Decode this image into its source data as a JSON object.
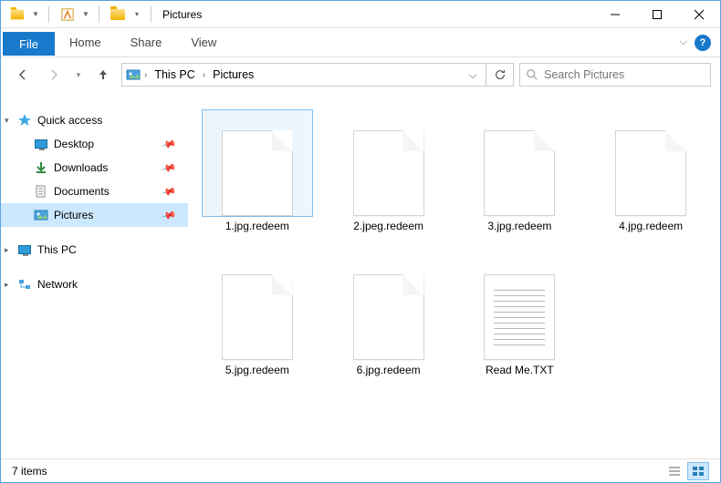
{
  "titlebar": {
    "title": "Pictures"
  },
  "ribbon": {
    "file": "File",
    "tabs": [
      "Home",
      "Share",
      "View"
    ]
  },
  "breadcrumb": {
    "items": [
      "This PC",
      "Pictures"
    ]
  },
  "search": {
    "placeholder": "Search Pictures"
  },
  "sidebar": {
    "quick_access": "Quick access",
    "items": [
      {
        "label": "Desktop",
        "icon": "desktop",
        "pinned": true
      },
      {
        "label": "Downloads",
        "icon": "downloads",
        "pinned": true
      },
      {
        "label": "Documents",
        "icon": "documents",
        "pinned": true
      },
      {
        "label": "Pictures",
        "icon": "pictures",
        "pinned": true,
        "selected": true
      }
    ],
    "this_pc": "This PC",
    "network": "Network"
  },
  "files": [
    {
      "name": "1.jpg.redeem",
      "type": "blank",
      "selected": true
    },
    {
      "name": "2.jpeg.redeem",
      "type": "blank"
    },
    {
      "name": "3.jpg.redeem",
      "type": "blank"
    },
    {
      "name": "4.jpg.redeem",
      "type": "blank"
    },
    {
      "name": "5.jpg.redeem",
      "type": "blank"
    },
    {
      "name": "6.jpg.redeem",
      "type": "blank"
    },
    {
      "name": "Read Me.TXT",
      "type": "text"
    }
  ],
  "statusbar": {
    "count": "7 items"
  }
}
